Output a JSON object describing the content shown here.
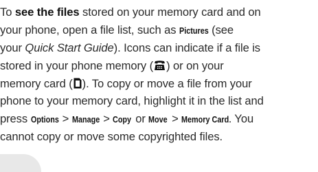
{
  "paragraph": {
    "l1_a": "To ",
    "l1_b": "see the files",
    "l1_c": " stored on your memory card and on",
    "l2": "your phone, open a file list, such as ",
    "l2_ui": "Pictures",
    "l2_c": " (see",
    "l3_a": "your ",
    "l3_b": "Quick Start Guide",
    "l3_c": "). Icons can indicate if a file is",
    "l4_a": "stored in your phone memory (",
    "l4_c": ") or on your",
    "l5_a": "memory card (",
    "l5_c": "). To copy or move a file from your",
    "l6": "phone to your memory card, highlight it in the list and",
    "l7_a": "press ",
    "l7_ui1": "Options",
    "l7_gt1": " > ",
    "l7_ui2": "Manage",
    "l7_gt2": " > ",
    "l7_ui3": "Copy",
    "l7_or": " or ",
    "l7_ui4": "Move",
    "l7_gt3": " > ",
    "l7_ui5": "Memory Card",
    "l7_end": ". You",
    "l8": "cannot copy or move some copyrighted files."
  },
  "icons": {
    "phone_memory": "phone-memory-icon",
    "memory_card": "memory-card-icon"
  },
  "colors": {
    "text": "#2a2a2a",
    "corner_mark": "#e8e8e8"
  }
}
